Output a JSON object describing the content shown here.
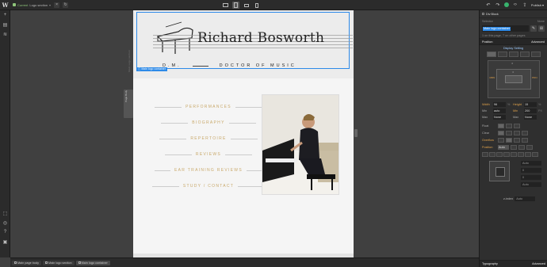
{
  "topbar": {
    "page_label": "Current",
    "page_name": "Logo section",
    "publish_label": "Publish",
    "devices": [
      "desktop",
      "tablet",
      "mobile-landscape",
      "mobile-portrait"
    ]
  },
  "left_toolbar": {
    "top_icons": [
      "add-icon",
      "pages-icon",
      "layers-icon"
    ],
    "bottom_icons": [
      "select-icon",
      "preview-icon",
      "help-icon",
      "settings-icon"
    ]
  },
  "canvas": {
    "gutter_text": "Main Logo section",
    "gutter_box_text": "Page Body",
    "site": {
      "name": "Richard Bosworth",
      "subtitle_left": "D.M.",
      "subtitle_right": "DOCTOR OF MUSIC",
      "selected_label": "Main logo container",
      "menu": [
        "PERFORMANCES",
        "BIOGRAPHY",
        "REPERTOIRE",
        "REVIEWS",
        "EAR TRAINING REVIEWS",
        "STUDY / CONTACT"
      ]
    }
  },
  "panel": {
    "element_title": "Div Block",
    "selector_label": "Selector",
    "selector_state": "None",
    "class_chip": "Main logo container",
    "note": "1 on this page, 7 on other pages",
    "position_section": "Position",
    "advanced_label": "Advanced",
    "display_setting": "Display Setting",
    "box": {
      "margin": "MRN",
      "padding": "PDN",
      "margin_values": "0",
      "padding_values": "0"
    },
    "sizing": [
      {
        "label": "Width",
        "value": "96",
        "unit": "%",
        "label2": "Height",
        "value2": "15",
        "unit2": "%"
      },
      {
        "label": "Min",
        "value": "auto",
        "unit": "",
        "label2": "Min",
        "value2": "200",
        "unit2": "PX"
      },
      {
        "label": "Max",
        "value": "None",
        "unit": "",
        "label2": "Max",
        "value2": "None",
        "unit2": ""
      }
    ],
    "float_label": "Float",
    "clear_label": "Clear",
    "overflow_label": "Overflow",
    "position_label": "Position",
    "position_value": "Auto",
    "auto_values": [
      "Auto",
      "0",
      "0",
      "Auto"
    ],
    "zindex_label": "z-index",
    "zindex_value": "Auto",
    "typography": "Typography",
    "typography_mode": "Advanced"
  },
  "breadcrumbs": [
    "Main page body",
    "Main logo section",
    "Main logo container"
  ]
}
